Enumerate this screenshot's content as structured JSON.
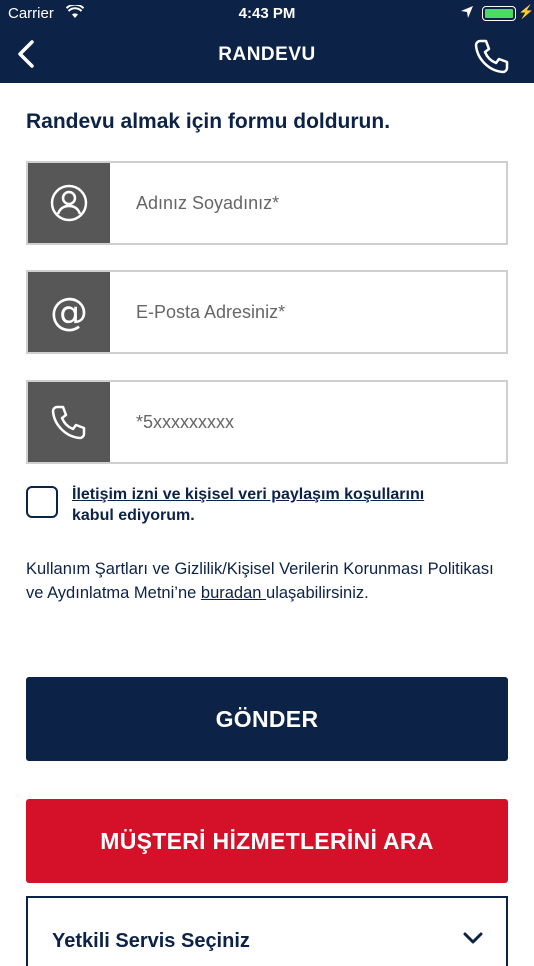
{
  "status_bar": {
    "carrier": "Carrier",
    "time": "4:43 PM"
  },
  "nav": {
    "title": "RANDEVU",
    "back_icon": "chevron-left-icon",
    "phone_icon": "phone-icon"
  },
  "form": {
    "heading": "Randevu almak için formu doldurun.",
    "name_placeholder": "Adınız Soyadınız*",
    "email_placeholder": "E-Posta Adresiniz*",
    "phone_placeholder": "*5xxxxxxxxx",
    "consent_link": "İletişim izni ve kişisel veri paylaşım koşullarını",
    "consent_rest": "kabul ediyorum.",
    "terms_before": "Kullanım Şartları ve Gizlilik/Kişisel Verilerin Korunması Politikası ve Aydınlatma Metni’ne ",
    "terms_link": "buradan ",
    "terms_after": "ulaşabilirsiniz.",
    "send_label": "GÖNDER",
    "call_label": "MÜŞTERİ HİZMETLERİNİ ARA",
    "service_select": "Yetkili Servis Seçiniz"
  },
  "colors": {
    "navy": "#0d2247",
    "red": "#d5112a",
    "icon_box": "#575757"
  }
}
